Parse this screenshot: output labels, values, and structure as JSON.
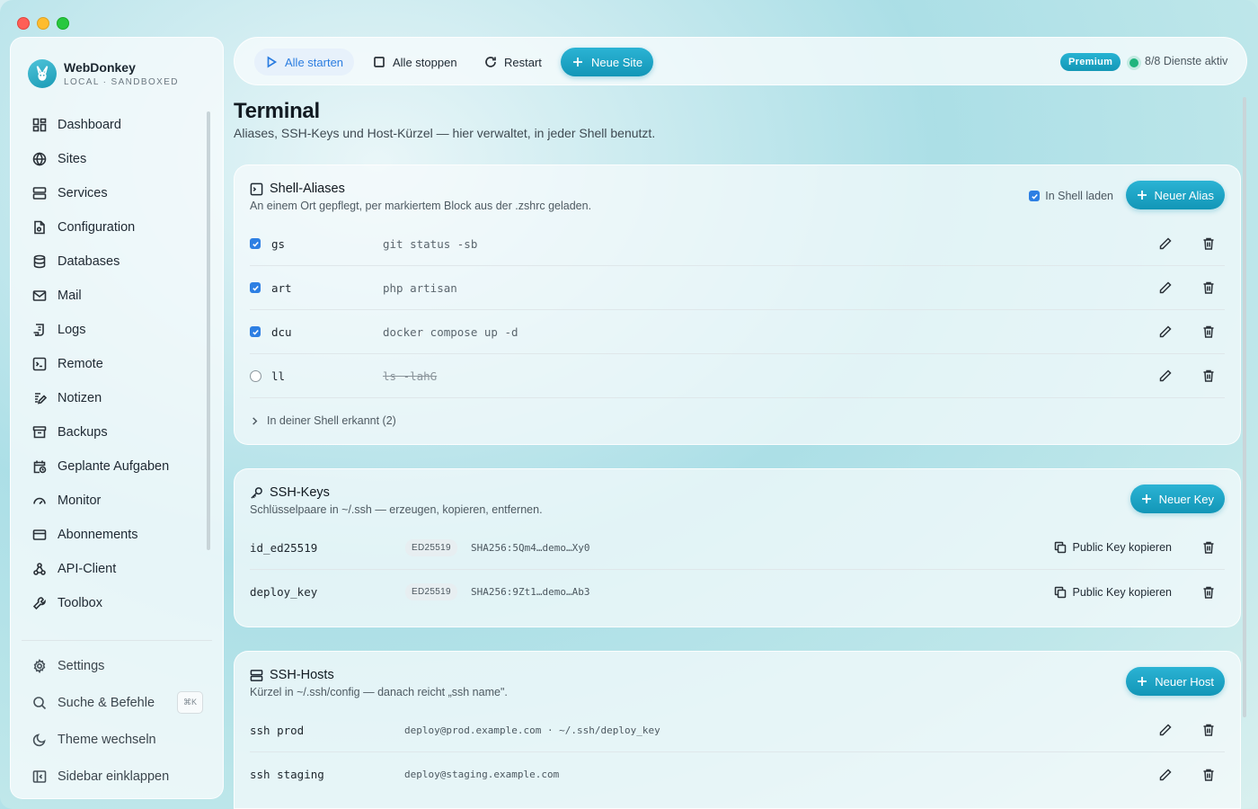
{
  "app": {
    "name": "WebDonkey",
    "subtitle": "LOCAL · SANDBOXED"
  },
  "sidebar": {
    "items": [
      {
        "label": "Dashboard",
        "icon": "dashboard-icon"
      },
      {
        "label": "Sites",
        "icon": "globe-icon"
      },
      {
        "label": "Services",
        "icon": "server-icon"
      },
      {
        "label": "Configuration",
        "icon": "config-file-icon"
      },
      {
        "label": "Databases",
        "icon": "database-icon"
      },
      {
        "label": "Mail",
        "icon": "mail-icon"
      },
      {
        "label": "Logs",
        "icon": "logs-icon"
      },
      {
        "label": "Remote",
        "icon": "terminal-icon"
      },
      {
        "label": "Notizen",
        "icon": "notes-icon"
      },
      {
        "label": "Backups",
        "icon": "archive-icon"
      },
      {
        "label": "Geplante Aufgaben",
        "icon": "calendar-clock-icon"
      },
      {
        "label": "Monitor",
        "icon": "gauge-icon"
      },
      {
        "label": "Abonnements",
        "icon": "credit-card-icon"
      },
      {
        "label": "API-Client",
        "icon": "webhook-icon"
      },
      {
        "label": "Toolbox",
        "icon": "wrench-icon"
      }
    ],
    "bottom": {
      "settings": "Settings",
      "search": "Suche & Befehle",
      "search_shortcut": "⌘K",
      "theme": "Theme wechseln",
      "collapse": "Sidebar einklappen"
    }
  },
  "toolbar": {
    "start_all": "Alle starten",
    "stop_all": "Alle stoppen",
    "restart": "Restart",
    "new_site": "Neue Site",
    "plan_badge": "Premium",
    "services_status": "8/8 Dienste aktiv",
    "status_color": "#1fb57d",
    "accent_color": "#1aa3c4"
  },
  "page": {
    "title": "Terminal",
    "subtitle": "Aliases, SSH-Keys und Host-Kürzel — hier verwaltet, in jeder Shell benutzt."
  },
  "aliases": {
    "title": "Shell-Aliases",
    "description": "An einem Ort gepflegt, per markiertem Block aus der .zshrc geladen.",
    "load_in_shell_label": "In Shell laden",
    "load_in_shell_checked": true,
    "new_button": "Neuer Alias",
    "rows": [
      {
        "name": "gs",
        "command": "git status -sb",
        "enabled": true
      },
      {
        "name": "art",
        "command": "php artisan",
        "enabled": true
      },
      {
        "name": "dcu",
        "command": "docker compose up -d",
        "enabled": true
      },
      {
        "name": "ll",
        "command": "ls -lahG",
        "enabled": false
      }
    ],
    "detected_label": "In deiner Shell erkannt (2)"
  },
  "ssh_keys": {
    "title": "SSH-Keys",
    "description": "Schlüsselpaare in ~/.ssh — erzeugen, kopieren, entfernen.",
    "new_button": "Neuer Key",
    "copy_label": "Public Key kopieren",
    "rows": [
      {
        "name": "id_ed25519",
        "type": "ED25519",
        "fingerprint": "SHA256:5Qm4…demo…Xy0"
      },
      {
        "name": "deploy_key",
        "type": "ED25519",
        "fingerprint": "SHA256:9Zt1…demo…Ab3"
      }
    ]
  },
  "ssh_hosts": {
    "title": "SSH-Hosts",
    "description": "Kürzel in ~/.ssh/config — danach reicht „ssh name\".",
    "new_button": "Neuer Host",
    "rows": [
      {
        "name": "ssh prod",
        "target": "deploy@prod.example.com · ~/.ssh/deploy_key"
      },
      {
        "name": "ssh staging",
        "target": "deploy@staging.example.com"
      }
    ]
  }
}
